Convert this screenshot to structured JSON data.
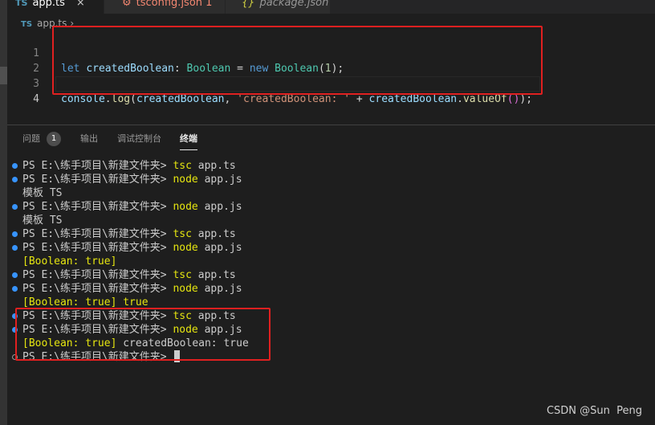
{
  "tabs": [
    {
      "badge": "TS",
      "label": "app.ts",
      "close": "×"
    },
    {
      "label": "tsconfig.json 1"
    },
    {
      "label": "package.json"
    }
  ],
  "breadcrumb": {
    "badge": "TS",
    "file": "app.ts",
    "chevron": "›"
  },
  "editor": {
    "lines": [
      {
        "n": "1"
      },
      {
        "n": "2"
      },
      {
        "n": "3"
      },
      {
        "n": "4"
      }
    ],
    "tokens": {
      "l1_let": "let",
      "l1_var": "createdBoolean",
      "l1_colon": ": ",
      "l1_type": "Boolean",
      "l1_eq": " = ",
      "l1_new": "new",
      "l1_ctor": "Boolean",
      "l1_po": "(",
      "l1_num": "1",
      "l1_pc": ");",
      "l3_console": "console",
      "l3_dot": ".",
      "l3_log": "log",
      "l3_po": "(",
      "l3_arg1": "createdBoolean",
      "l3_comma": ", ",
      "l3_str": "'createdBoolean: '",
      "l3_plus": " + ",
      "l3_arg2": "createdBoolean",
      "l3_dot2": ".",
      "l3_valueOf": "valueOf",
      "l3_inner": "()",
      "l3_pc": ")",
      "l3_semi": ";"
    }
  },
  "panel": {
    "tabs": [
      {
        "label": "问题",
        "badge": "1"
      },
      {
        "label": "输出"
      },
      {
        "label": "调试控制台"
      },
      {
        "label": "终端"
      }
    ]
  },
  "terminal": {
    "prompt": "PS E:\\练手项目\\新建文件夹> ",
    "lines": [
      {
        "kind": "cmd",
        "cmd": "tsc",
        "arg": " app.ts"
      },
      {
        "kind": "cmd",
        "cmd": "node",
        "arg": " app.js"
      },
      {
        "kind": "out",
        "text": "模板 TS"
      },
      {
        "kind": "cmd",
        "cmd": "node",
        "arg": " app.js"
      },
      {
        "kind": "out",
        "text": "模板 TS"
      },
      {
        "kind": "cmd",
        "cmd": "tsc",
        "arg": " app.ts"
      },
      {
        "kind": "cmd",
        "cmd": "node",
        "arg": " app.js"
      },
      {
        "kind": "out",
        "yellow": "[Boolean: true]",
        "text": ""
      },
      {
        "kind": "cmd",
        "cmd": "tsc",
        "arg": " app.ts"
      },
      {
        "kind": "cmd",
        "cmd": "node",
        "arg": " app.js"
      },
      {
        "kind": "out",
        "yellow": "[Boolean: true] true",
        "text": ""
      },
      {
        "kind": "cmd",
        "cmd": "tsc",
        "arg": " app.ts"
      },
      {
        "kind": "cmd",
        "cmd": "node",
        "arg": " app.js"
      },
      {
        "kind": "out",
        "yellow": "[Boolean: true]",
        "text": " createdBoolean: true"
      },
      {
        "kind": "prompt"
      }
    ]
  },
  "watermark": "CSDN @Sun  Peng",
  "colors": {
    "highlight_box": "#e02020",
    "terminal_dot": "#3794ff",
    "ts_badge": "#519aba"
  }
}
